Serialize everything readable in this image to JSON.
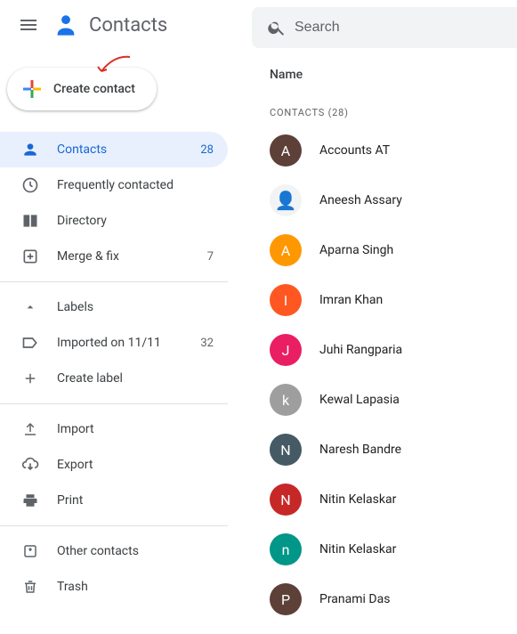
{
  "app": {
    "title": "Contacts"
  },
  "search": {
    "placeholder": "Search"
  },
  "create": {
    "label": "Create contact"
  },
  "sidebar": {
    "items": [
      {
        "label": "Contacts",
        "count": "28",
        "icon": "person-icon",
        "active": true
      },
      {
        "label": "Frequently contacted",
        "count": "",
        "icon": "history-icon"
      },
      {
        "label": "Directory",
        "count": "",
        "icon": "directory-icon"
      },
      {
        "label": "Merge & fix",
        "count": "7",
        "icon": "merge-icon"
      }
    ],
    "labels_header": "Labels",
    "labels": [
      {
        "label": "Imported on 11/11",
        "count": "32",
        "icon": "label-icon"
      },
      {
        "label": "Create label",
        "count": "",
        "icon": "plus-icon"
      }
    ],
    "io": [
      {
        "label": "Import",
        "icon": "upload-icon"
      },
      {
        "label": "Export",
        "icon": "cloud-download-icon"
      },
      {
        "label": "Print",
        "icon": "print-icon"
      }
    ],
    "other": [
      {
        "label": "Other contacts",
        "icon": "archive-icon"
      },
      {
        "label": "Trash",
        "icon": "trash-icon"
      }
    ]
  },
  "main": {
    "column_header": "Name",
    "section_label": "CONTACTS (28)",
    "contacts": [
      {
        "initial": "A",
        "name": "Accounts AT",
        "color": "#5d4037"
      },
      {
        "initial": "",
        "name": "Aneesh Assary",
        "color": "image"
      },
      {
        "initial": "A",
        "name": "Aparna Singh",
        "color": "#ff9800"
      },
      {
        "initial": "I",
        "name": "Imran Khan",
        "color": "#ff5722"
      },
      {
        "initial": "J",
        "name": "Juhi Rangparia",
        "color": "#e91e63"
      },
      {
        "initial": "k",
        "name": "Kewal Lapasia",
        "color": "#9e9e9e"
      },
      {
        "initial": "N",
        "name": "Naresh Bandre",
        "color": "#455a64"
      },
      {
        "initial": "N",
        "name": "Nitin Kelaskar",
        "color": "#c62828"
      },
      {
        "initial": "n",
        "name": "Nitin Kelaskar",
        "color": "#009688"
      },
      {
        "initial": "P",
        "name": "Pranami Das",
        "color": "#5d4037"
      }
    ]
  }
}
